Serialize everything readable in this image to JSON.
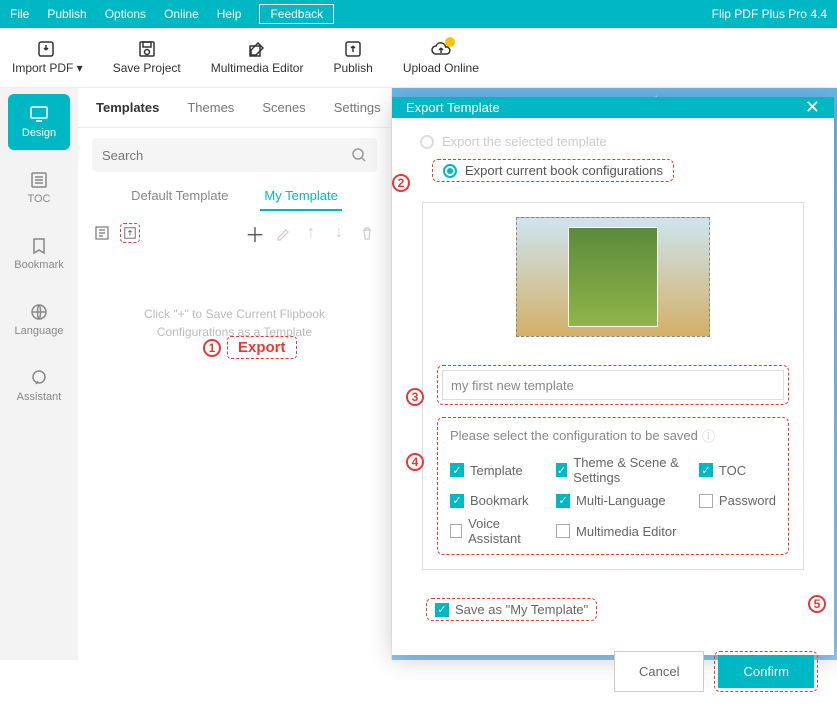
{
  "menubar": {
    "items": [
      "File",
      "Publish",
      "Options",
      "Online",
      "Help"
    ],
    "feedback": "Feedback",
    "app_title": "Flip PDF Plus Pro 4.4"
  },
  "toolbar": {
    "import_pdf": "Import PDF",
    "save_project": "Save Project",
    "multimedia_editor": "Multimedia Editor",
    "publish": "Publish",
    "upload_online": "Upload Online"
  },
  "sidebar": {
    "items": [
      {
        "label": "Design"
      },
      {
        "label": "TOC"
      },
      {
        "label": "Bookmark"
      },
      {
        "label": "Language"
      },
      {
        "label": "Assistant"
      }
    ]
  },
  "panel": {
    "tabs": [
      "Templates",
      "Themes",
      "Scenes",
      "Settings"
    ],
    "search_placeholder": "Search",
    "template_tabs": [
      "Default Template",
      "My Template"
    ],
    "empty_msg": "Click \"+\" to Save Current Flipbook Configurations as a Template"
  },
  "annotations": {
    "export": "Export"
  },
  "modal": {
    "title": "Export Template",
    "option_selected": "Export the selected template",
    "option_current": "Export current book configurations",
    "template_name": "my first new template",
    "config_title": "Please select the configuration to be saved",
    "configs": {
      "template": "Template",
      "theme": "Theme & Scene & Settings",
      "toc": "TOC",
      "bookmark": "Bookmark",
      "multilang": "Multi-Language",
      "password": "Password",
      "voice": "Voice Assistant",
      "multimedia": "Multimedia Editor"
    },
    "save_as": "Save as \"My Template\"",
    "cancel": "Cancel",
    "confirm": "Confirm"
  }
}
